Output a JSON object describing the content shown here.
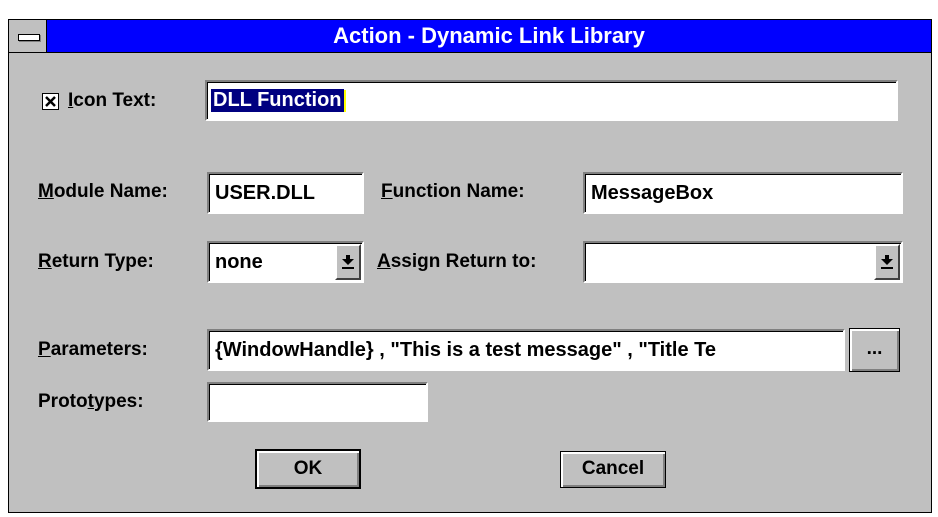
{
  "window": {
    "title": "Action - Dynamic Link Library"
  },
  "icon_text": {
    "checked": true,
    "label_hotkey": "I",
    "label_rest": "con Text:",
    "selected_value": "DLL Function"
  },
  "module_name": {
    "label_hotkey": "M",
    "label_rest": "odule Name:",
    "value": "USER.DLL"
  },
  "function_name": {
    "label_hotkey": "F",
    "label_rest": "unction Name:",
    "value": "MessageBox"
  },
  "return_type": {
    "label_hotkey": "R",
    "label_rest": "eturn Type:",
    "value": "none"
  },
  "assign_return": {
    "label_hotkey": "A",
    "label_rest": "ssign Return to:",
    "value": ""
  },
  "parameters": {
    "label_hotkey": "P",
    "label_rest": "arameters:",
    "value": "{WindowHandle} , \"This is a test message\" , \"Title Te",
    "browse_label": "..."
  },
  "prototypes": {
    "label_before": "Proto",
    "label_hotkey": "t",
    "label_after": "ypes:",
    "value": ""
  },
  "buttons": {
    "ok_hotkey": "O",
    "ok_rest": "K",
    "cancel_hotkey": "C",
    "cancel_rest": "ancel"
  },
  "icons": {
    "system_menu": "system-menu-icon",
    "dropdown": "dropdown-arrow-icon",
    "checkbox": "checkbox-x-icon"
  }
}
